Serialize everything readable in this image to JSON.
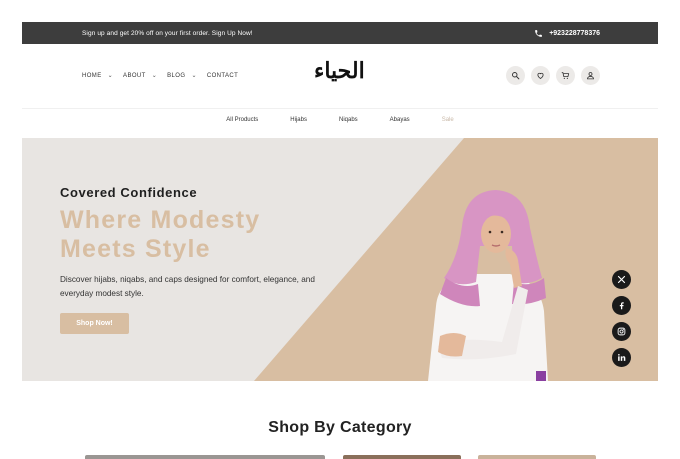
{
  "topbar": {
    "promo": "Sign up and get 20% off on your first order. Sign Up Now!",
    "phone": "+923228778376"
  },
  "header": {
    "nav": [
      {
        "label": "HOME",
        "has_dropdown": true
      },
      {
        "label": "ABOUT",
        "has_dropdown": true
      },
      {
        "label": "BLOG",
        "has_dropdown": true
      },
      {
        "label": "CONTACT",
        "has_dropdown": false
      }
    ],
    "logo": "الحياء",
    "icons": [
      "search-icon",
      "heart-icon",
      "cart-icon",
      "user-icon"
    ]
  },
  "categories": [
    "All Products",
    "Hijabs",
    "Niqabs",
    "Abayas",
    "Sale"
  ],
  "hero": {
    "subtitle": "Covered Confidence",
    "title_line1": "Where Modesty",
    "title_line2": "Meets Style",
    "description": "Discover hijabs, niqabs, and caps designed for comfort, elegance, and everyday modest style.",
    "cta": "Shop Now!"
  },
  "socials": [
    "x-icon",
    "facebook-icon",
    "instagram-icon",
    "linkedin-icon"
  ],
  "section": {
    "title": "Shop By Category"
  },
  "colors": {
    "accent": "#d8bea2",
    "topbar": "#3d3d3d",
    "hero_bg": "#e8e5e2",
    "hero_panel": "#d8bea2"
  }
}
